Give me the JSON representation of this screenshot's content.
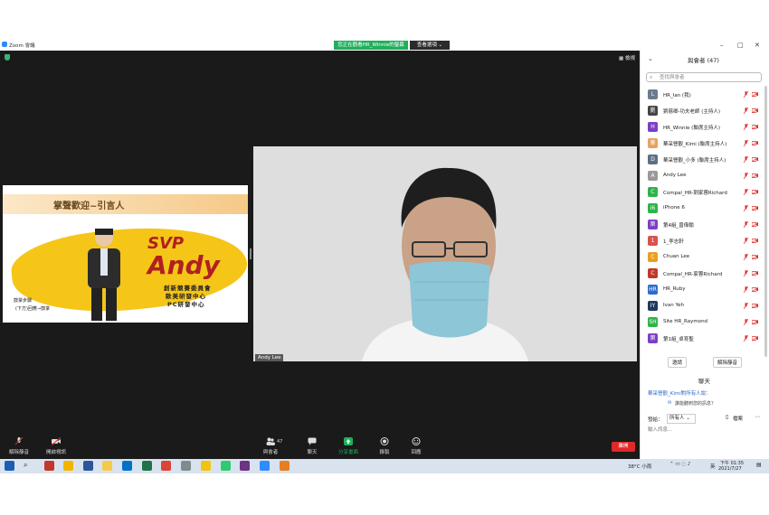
{
  "window": {
    "title": "Zoom 會議",
    "share_banner": "您正在觀看HR_Winnie的螢幕",
    "view_options": "查看選項 ⌄",
    "minimize": "–",
    "maximize": "□",
    "close": "✕"
  },
  "meeting": {
    "view_label": "▦ 檢視",
    "video_name": "Andy Lee"
  },
  "slide": {
    "welcome": "掌聲歡迎~引言人",
    "svp": "SVP",
    "name": "Andy",
    "line1": "創新競賽委員會",
    "line2": "歐美研發中心",
    "line3": "PC研發中心",
    "applause1": "鼓掌步驟",
    "applause2": "(下方)回應→鼓掌"
  },
  "toolbar": {
    "mute": "解除靜音",
    "video": "開啟視訊",
    "participants": "與會者",
    "participants_count": "47",
    "chat": "聊天",
    "share": "分享畫面",
    "record": "錄製",
    "reactions": "回應",
    "end": "離開"
  },
  "panel": {
    "title": "與會者 (47)",
    "search_placeholder": "查找與會者",
    "participants": [
      {
        "name": "HR_Ian (我)",
        "initial": "L",
        "color": "#6a7b8c"
      },
      {
        "name": "劉慈卿-功夫老師 (主持人)",
        "initial": "劉",
        "color": "#444444"
      },
      {
        "name": "HR_Winnie (聯席主持人)",
        "initial": "H",
        "color": "#7b3fc4"
      },
      {
        "name": "華采營觀_Kimi (聯席主持人)",
        "initial": "華",
        "color": "#e8a060"
      },
      {
        "name": "華采營觀_小多 (聯席主持人)",
        "initial": "D",
        "color": "#5b7083"
      },
      {
        "name": "Andy Lee",
        "initial": "A",
        "color": "#999999"
      },
      {
        "name": "Compal_HR-劉家蓉Richard",
        "initial": "C",
        "color": "#2fb34a"
      },
      {
        "name": "iPhone 6",
        "initial": "i6",
        "color": "#2fb34a"
      },
      {
        "name": "第4組_曾偉翰",
        "initial": "第",
        "color": "#7b3fc4"
      },
      {
        "name": "1_李志軒",
        "initial": "1",
        "color": "#d9534f"
      },
      {
        "name": "Chuan Lee",
        "initial": "C",
        "color": "#e8a020"
      },
      {
        "name": "Compal_HR-家蓉Richard",
        "initial": "C",
        "color": "#c0392b"
      },
      {
        "name": "HR_Ruby",
        "initial": "HR",
        "color": "#2d6bd1"
      },
      {
        "name": "Ivan Yeh",
        "initial": "IY",
        "color": "#1f3a5f"
      },
      {
        "name": "Site HR_Raymond",
        "initial": "SH",
        "color": "#2fb34a"
      },
      {
        "name": "第1組_卓育聖",
        "initial": "第",
        "color": "#7b3fc4"
      }
    ],
    "invite": "邀請",
    "mute_all": "解除靜音"
  },
  "chat": {
    "title": "聊天",
    "from": "華采營觀_Kimi對所有人說：",
    "message": "誰能聽到您的訊息？",
    "send_to_label": "發給：",
    "recipient": "所有人 ⌄",
    "file_label": "檔案",
    "input_placeholder": "輸入訊息..."
  },
  "taskbar": {
    "weather": "38°C 小雨",
    "lang": "英",
    "time": "下午 01:35",
    "date": "2021/7/27"
  },
  "colors": {
    "dark_bg": "#1a1a1a",
    "share_green": "#1fb05a",
    "end_red": "#e02828",
    "accent_blue": "#2d8cff"
  }
}
